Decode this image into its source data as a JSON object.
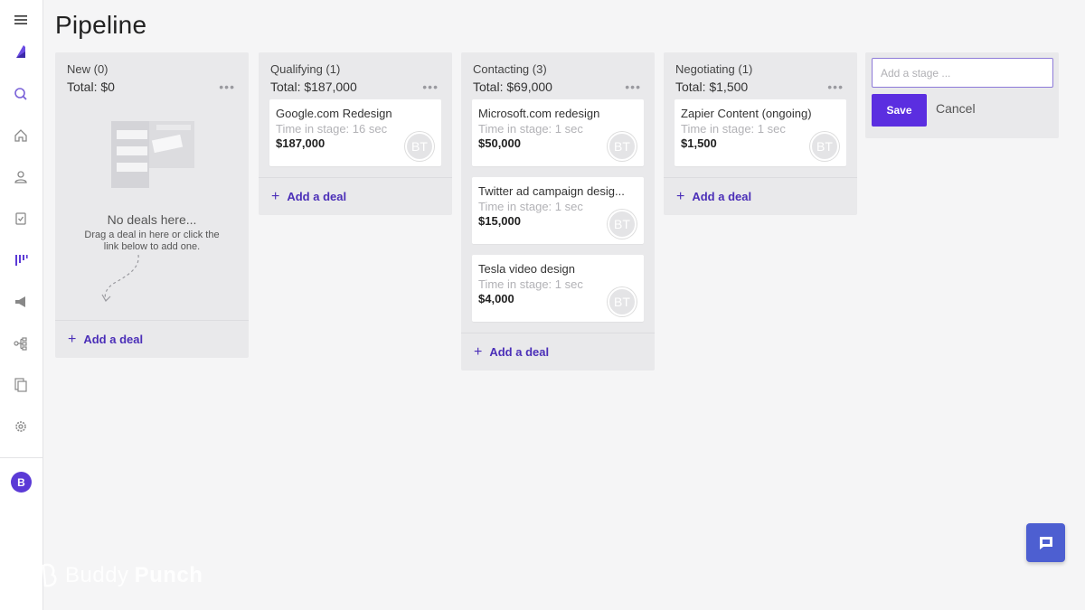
{
  "page": {
    "title": "Pipeline"
  },
  "sidebar": {
    "icons": [
      "menu-icon",
      "logo-icon",
      "search-icon",
      "home-icon",
      "contacts-icon",
      "tasks-icon",
      "pipeline-icon",
      "campaigns-icon",
      "automation-icon",
      "documents-icon",
      "settings-icon"
    ],
    "avatar_initial": "B",
    "accent": "#5b3ad6"
  },
  "columns": [
    {
      "name": "New (0)",
      "total": "Total: $0",
      "more": "•••",
      "deals": [],
      "empty_title": "No deals here...",
      "empty_sub_1": "Drag a deal in here or click the",
      "empty_sub_2": "link below to add one.",
      "add_label": "Add a deal"
    },
    {
      "name": "Qualifying (1)",
      "total": "Total: $187,000",
      "more": "•••",
      "deals": [
        {
          "title": "Google.com Redesign",
          "time": "Time in stage: 16 sec",
          "value": "$187,000",
          "owner": "BT"
        }
      ],
      "add_label": "Add a deal"
    },
    {
      "name": "Contacting (3)",
      "total": "Total: $69,000",
      "more": "•••",
      "deals": [
        {
          "title": "Microsoft.com redesign",
          "time": "Time in stage: 1 sec",
          "value": "$50,000",
          "owner": "BT"
        },
        {
          "title": "Twitter ad campaign desig...",
          "time": "Time in stage: 1 sec",
          "value": "$15,000",
          "owner": "BT"
        },
        {
          "title": "Tesla video design",
          "time": "Time in stage: 1 sec",
          "value": "$4,000",
          "owner": "BT"
        }
      ],
      "add_label": "Add a deal"
    },
    {
      "name": "Negotiating (1)",
      "total": "Total: $1,500",
      "more": "•••",
      "deals": [
        {
          "title": "Zapier Content (ongoing)",
          "time": "Time in stage: 1 sec",
          "value": "$1,500",
          "owner": "BT"
        }
      ],
      "add_label": "Add a deal"
    }
  ],
  "stage_form": {
    "placeholder": "Add a stage ...",
    "value": "",
    "save_label": "Save",
    "cancel_label": "Cancel",
    "save_color": "#5b2ee0"
  },
  "chat": {
    "icon": "chat-icon",
    "color": "#4d5fd1"
  },
  "watermark": {
    "text_1": "Buddy",
    "text_2": "Punch"
  }
}
